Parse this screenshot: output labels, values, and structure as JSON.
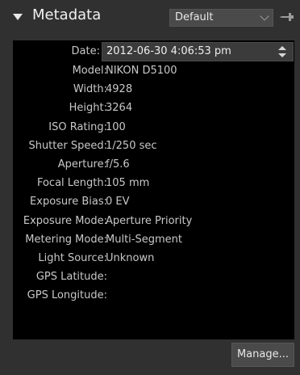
{
  "panel": {
    "title": "Metadata",
    "preset": "Default",
    "icons": {
      "collapse": "triangle-down-icon",
      "pin": "pin-icon",
      "chevron": "chevron-down-icon"
    }
  },
  "date": {
    "label": "Date:",
    "value": "2012-06-30 4:06:53 pm"
  },
  "fields": [
    {
      "label": "Model:",
      "value": "NIKON D5100"
    },
    {
      "label": "Width:",
      "value": "4928"
    },
    {
      "label": "Height:",
      "value": "3264"
    },
    {
      "label": "ISO Rating:",
      "value": "100"
    },
    {
      "label": "Shutter Speed:",
      "value": "1/250 sec"
    },
    {
      "label": "Aperture:",
      "value": "f/5.6"
    },
    {
      "label": "Focal Length:",
      "value": "105 mm"
    },
    {
      "label": "Exposure Bias:",
      "value": "0 EV"
    },
    {
      "label": "Exposure Mode:",
      "value": "Aperture Priority"
    },
    {
      "label": "Metering Mode:",
      "value": "Multi-Segment"
    },
    {
      "label": "Light Source:",
      "value": "Unknown"
    },
    {
      "label": "GPS Latitude:",
      "value": ""
    },
    {
      "label": "GPS Longitude:",
      "value": ""
    }
  ],
  "manage_label": "Manage..."
}
